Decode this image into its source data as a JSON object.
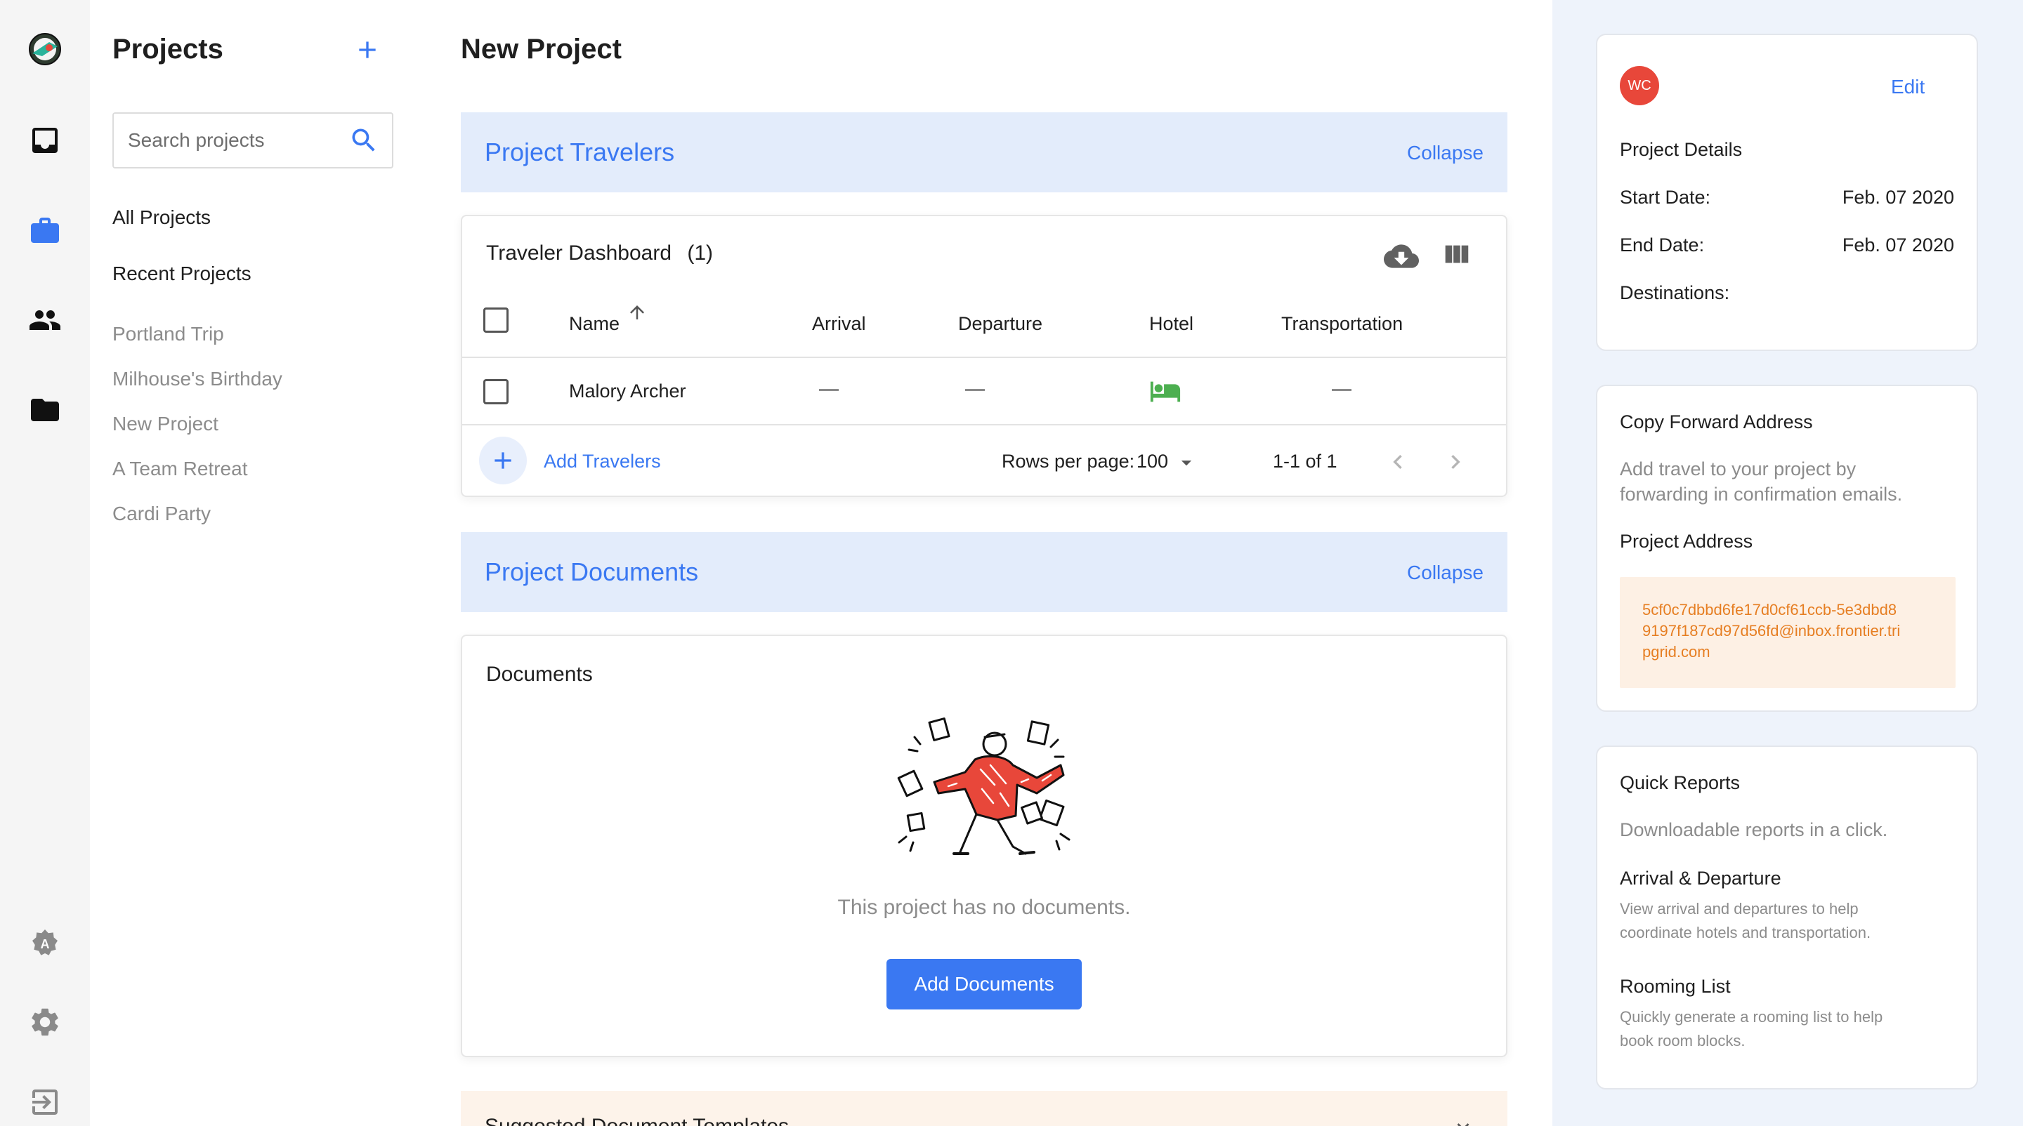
{
  "rail": {
    "items": [
      "logo-icon",
      "inbox-icon",
      "briefcase-icon",
      "people-icon",
      "folder-icon",
      "admin-icon",
      "gear-icon",
      "logout-icon"
    ],
    "active_color": "#3a78f2"
  },
  "sidebar": {
    "title": "Projects",
    "search_placeholder": "Search projects",
    "nav": [
      "All Projects",
      "Recent Projects"
    ],
    "recent": [
      "Portland Trip",
      "Milhouse's Birthday",
      "New Project",
      "A Team Retreat",
      "Cardi Party"
    ]
  },
  "main": {
    "title": "New Project",
    "travelers_section": {
      "title": "Project Travelers",
      "collapse": "Collapse",
      "dashboard_title": "Traveler Dashboard",
      "count": "(1)",
      "columns": [
        "Name",
        "Arrival",
        "Departure",
        "Hotel",
        "Transportation"
      ],
      "rows": [
        {
          "name": "Malory Archer",
          "arrival": "",
          "departure": "",
          "hotel": "bed-icon",
          "transportation": ""
        }
      ],
      "add_travelers": "Add Travelers",
      "rows_per_page_label": "Rows per page:",
      "rows_per_page": "100",
      "pagination": "1-1 of 1"
    },
    "documents_section": {
      "title": "Project Documents",
      "collapse": "Collapse",
      "card_title": "Documents",
      "empty_text": "This project has no documents.",
      "add_button": "Add Documents"
    },
    "templates_section": {
      "title": "Suggested Document Templates"
    },
    "colors": {
      "accent": "#3a78f2",
      "section_bg": "#e3ecfb",
      "hotel_icon": "#4caf50",
      "illustration_red": "#e8473a"
    }
  },
  "right_panel": {
    "details": {
      "avatar_initials": "WC",
      "avatar_color": "#e8473a",
      "edit": "Edit",
      "heading": "Project Details",
      "start_label": "Start Date:",
      "start_value": "Feb. 07 2020",
      "end_label": "End Date:",
      "end_value": "Feb. 07 2020",
      "destinations_label": "Destinations:"
    },
    "forward": {
      "heading": "Copy Forward Address",
      "description_1": "Add travel to your project by",
      "description_2": "forwarding in confirmation emails.",
      "address_label": "Project Address",
      "address_1": "5cf0c7dbbd6fe17d0cf61ccb-5e3dbd8",
      "address_2": "9197f187cd97d56fd@inbox.frontier.tri",
      "address_3": "pgrid.com",
      "address_color": "#e67e22"
    },
    "reports": {
      "heading": "Quick Reports",
      "description": "Downloadable reports in a click.",
      "items": [
        {
          "title": "Arrival & Departure",
          "desc_1": "View arrival and departures to help",
          "desc_2": "coordinate hotels and transportation."
        },
        {
          "title": "Rooming List",
          "desc_1": "Quickly generate a rooming list to help",
          "desc_2": "book room blocks."
        }
      ]
    }
  }
}
